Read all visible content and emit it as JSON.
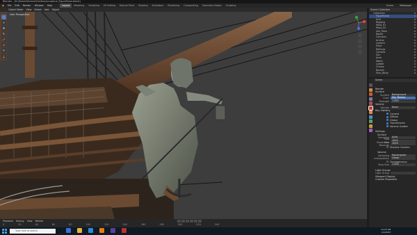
{
  "title": "Blender - [D:\\Shared\\Scenes\\Galleon\\sculpture_FigureHead.blend]",
  "menu": [
    "File",
    "Edit",
    "Render",
    "Window",
    "Help"
  ],
  "workspace_tabs": [
    "Layout",
    "Modeling",
    "Sculpting",
    "UV Editing",
    "Texture Paint",
    "Shading",
    "Animation",
    "Rendering",
    "Compositing",
    "Geometry Nodes",
    "Scripting"
  ],
  "scene_label": "Scene",
  "view_layer_label": "ViewLayer",
  "viewport_header": [
    "Object Mode",
    "View",
    "Select",
    "Add",
    "Object"
  ],
  "viewport_overlay_text": "User Perspective",
  "outliner": {
    "header": "Scene Collection",
    "items": [
      "Collection",
      "Figurehead",
      "Hull",
      "Rigging",
      "Mast_01",
      "Mast_02",
      "Sail_Main",
      "Ropes",
      "Cannons",
      "Anchor",
      "Lantern",
      "Deck",
      "Railings",
      "Camera",
      "Sun",
      "Area",
      "Water",
      "Ladder",
      "Chains",
      "Barrels",
      "Ship_Body"
    ]
  },
  "properties": {
    "header": "Scene",
    "sections": {
      "render_label": "Render",
      "surface_label": "Surface",
      "surface_value": "Background",
      "color_label": "Color",
      "color_value": "Sky Texture",
      "strength_label": "Strength",
      "strength_value": "1.000",
      "volume_label": "Volume",
      "volume_value": "None",
      "ray_vis_label": "Ray Visibility",
      "ray_vis": [
        "Camera",
        "Diffuse",
        "Glossy",
        "Transmission",
        "Volume Scatter"
      ],
      "settings_label": "Settings",
      "surface2_label": "Surface",
      "sampling_label": "Sampling",
      "sampling_value": "Auto",
      "map_res_label": "Map Resolution",
      "map_res_value": "1024",
      "max_bounces_label": "Max Bounces",
      "max_bounces_value": "1024",
      "shadow_caustics_label": "Shadow Caustics",
      "volume2_label": "Volume",
      "vol_sampling_label": "Sampling",
      "vol_sampling_value": "Equiangular",
      "interpolation_label": "Interpolation",
      "interpolation_value": "Linear",
      "homogeneous_label": "Homogeneous",
      "step_size_label": "Step Size",
      "step_size_value": "1.000",
      "light_groups_label": "Light Groups",
      "light_group_label": "Light Group",
      "viewport_display_label": "Viewport Display",
      "custom_props_label": "Custom Properties"
    }
  },
  "timeline": {
    "menus": [
      "Playback",
      "Keying",
      "View",
      "Marker"
    ],
    "frame_labels": [
      "0",
      "20",
      "40",
      "60",
      "80",
      "100",
      "120",
      "140",
      "160",
      "180",
      "200",
      "220",
      "240"
    ]
  },
  "statusbar": {
    "search_placeholder": "Type here to search",
    "time": "10:16 AM",
    "date": "1/4/2023"
  },
  "colors": {
    "accent": "#4772b3",
    "viewport_bg": "#3d3d3d",
    "wood": "#6b4a32"
  }
}
